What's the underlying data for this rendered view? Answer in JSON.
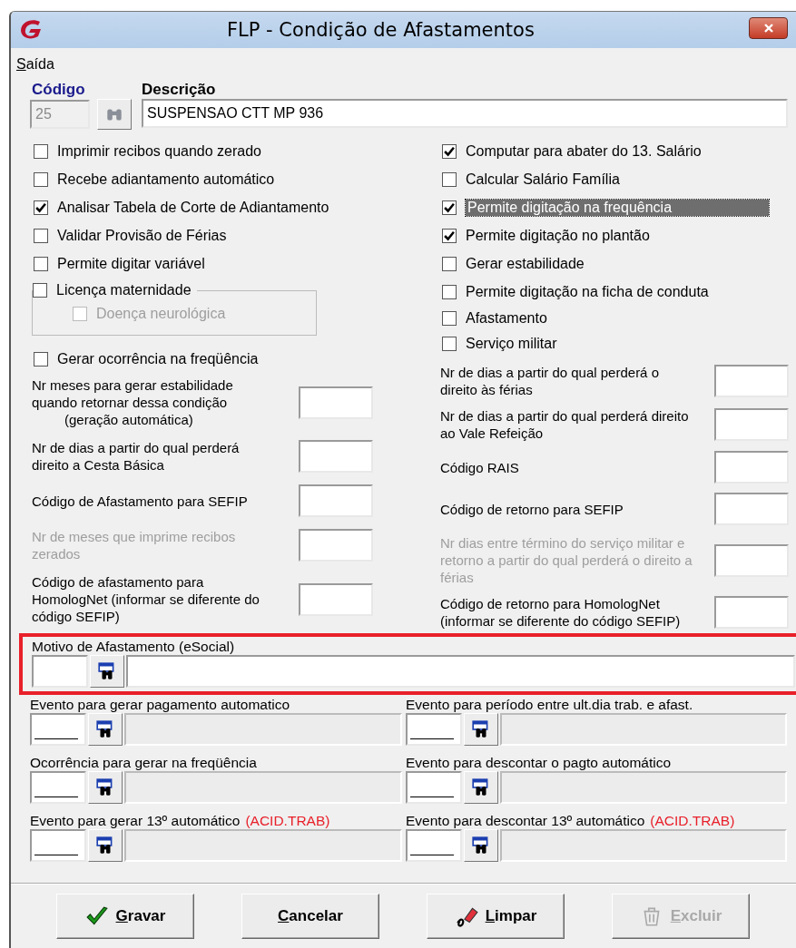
{
  "window": {
    "title": "FLP - Condição de Afastamentos"
  },
  "menu": [
    "Saída"
  ],
  "codigo": {
    "label": "Código",
    "value": "25",
    "disabled": true
  },
  "descricao": {
    "label": "Descrição",
    "value": "SUSPENSAO CTT MP 936"
  },
  "left_checks": [
    {
      "label": "Imprimir recibos quando zerado",
      "checked": false
    },
    {
      "label": "Recebe adiantamento automático",
      "checked": false
    },
    {
      "label": "Analisar Tabela de Corte de Adiantamento",
      "checked": true
    },
    {
      "label": "Validar Provisão de Férias",
      "checked": false
    },
    {
      "label": "Permite digitar variável",
      "checked": false
    }
  ],
  "licenca": {
    "label": "Licença maternidade",
    "checked": false,
    "child": {
      "label": "Doença neurológica",
      "checked": false,
      "disabled": true
    }
  },
  "ocorrencia_check": {
    "label": "Gerar ocorrência na freqüência",
    "checked": false
  },
  "right_checks": [
    {
      "label": "Computar para abater do 13. Salário",
      "checked": true,
      "selected": false
    },
    {
      "label": "Calcular Salário Família",
      "checked": false,
      "selected": false
    },
    {
      "label": "Permite digitação na frequência",
      "checked": true,
      "selected": true
    },
    {
      "label": "Permite digitação no plantão",
      "checked": true,
      "selected": false
    },
    {
      "label": "Gerar estabilidade",
      "checked": false,
      "selected": false
    },
    {
      "label": "Permite digitação na ficha de conduta",
      "checked": false,
      "selected": false
    },
    {
      "label": "Afastamento",
      "checked": false,
      "selected": false
    },
    {
      "label": "Serviço militar",
      "checked": false,
      "selected": false
    }
  ],
  "left_fields": [
    {
      "label": "Nr meses para gerar estabilidade quando retornar dessa condição",
      "sub": "(geração automática)",
      "disabled": false
    },
    {
      "label": "Nr de dias a partir do qual perderá direito a Cesta Básica",
      "disabled": false
    },
    {
      "label": "Código de Afastamento para SEFIP",
      "disabled": false
    },
    {
      "label": "Nr de meses que imprime recibos zerados",
      "disabled": true
    },
    {
      "label": "Código de afastamento para HomologNet (informar se diferente do código SEFIP)",
      "disabled": false
    }
  ],
  "right_fields": [
    {
      "label": "Nr de dias a partir do qual perderá o direito às férias",
      "disabled": false
    },
    {
      "label": "Nr de dias a partir do qual perderá direito ao Vale Refeição",
      "disabled": false
    },
    {
      "label": "Código RAIS",
      "disabled": false
    },
    {
      "label": "Código de retorno para SEFIP",
      "disabled": false
    },
    {
      "label": "Nr dias entre término do serviço militar e retorno  a partir do qual perderá o direito a férias",
      "disabled": true
    },
    {
      "label": "Código de retorno para HomologNet (informar se diferente do código SEFIP)",
      "disabled": false
    }
  ],
  "motivo": {
    "label": "Motivo de Afastamento (eSocial)",
    "highlighted": true
  },
  "events": [
    {
      "label": "Evento para gerar pagamento automatico"
    },
    {
      "label": "Evento para período entre ult.dia trab. e afast."
    },
    {
      "label": "Ocorrência para gerar na freqüência"
    },
    {
      "label": "Evento para descontar o pagto automático"
    },
    {
      "label": "Evento para gerar 13º automático",
      "note": "(ACID.TRAB)"
    },
    {
      "label": "Evento para descontar 13º automático",
      "note": "(ACID.TRAB)"
    }
  ],
  "buttons": [
    {
      "label": "Gravar",
      "kind": "save",
      "disabled": false
    },
    {
      "label": "Cancelar",
      "kind": "cancel",
      "disabled": false
    },
    {
      "label": "Limpar",
      "kind": "clear",
      "disabled": false
    },
    {
      "label": "Excluir",
      "kind": "delete",
      "disabled": true
    }
  ]
}
